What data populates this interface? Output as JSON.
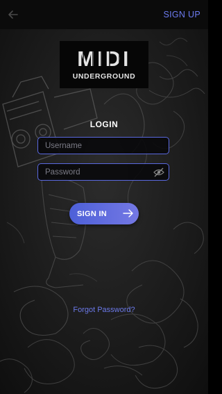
{
  "topbar": {
    "back_icon": "arrow-left-icon",
    "signup_label": "SIGN UP"
  },
  "logo": {
    "line1": "MIDI",
    "line2": "UNDERGROUND"
  },
  "login": {
    "heading": "LOGIN",
    "username_placeholder": "Username",
    "username_value": "",
    "password_placeholder": "Password",
    "password_value": "",
    "password_toggle_icon": "eye-off-icon",
    "signin_label": "SIGN IN",
    "signin_icon": "arrow-right-icon",
    "forgot_label": "Forgot Password?"
  },
  "colors": {
    "accent": "#5a69e0",
    "link": "#6c7bf0",
    "button_gradient_start": "#4d60d8",
    "button_gradient_end": "#7478e4",
    "background": "#141414"
  }
}
